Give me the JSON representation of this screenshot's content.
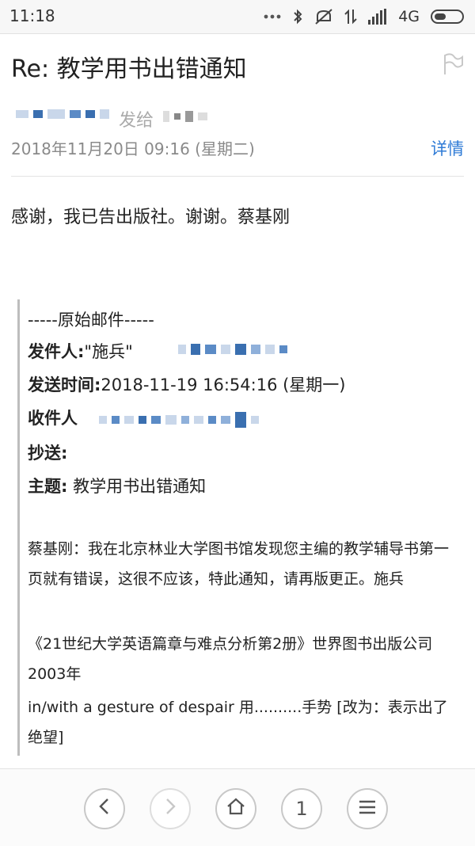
{
  "status": {
    "time": "11:18",
    "network": "4G"
  },
  "email": {
    "subject": "Re: 教学用书出错通知",
    "send_to_label": "发给",
    "date": "2018年11月20日 09:16 (星期二)",
    "details_label": "详情",
    "body": "感谢，我已告出版社。谢谢。蔡基刚",
    "quote": {
      "header": "-----原始邮件-----",
      "from_label": "发件人:",
      "from_value": "\"施兵\"",
      "sent_label": "发送时间:",
      "sent_value": "2018-11-19 16:54:16 (星期一)",
      "to_label": "收件人",
      "cc_label": "抄送:",
      "subject_label": "主题:",
      "subject_value": "教学用书出错通知",
      "para1": "蔡基刚：我在北京林业大学图书馆发现您主编的教学辅导书第一页就有错误，这很不应该，特此通知，请再版更正。施兵",
      "para2": "《21世纪大学英语篇章与难点分析第2册》世界图书出版公司2003年",
      "para3": "in/with a gesture of despair 用..........手势 [改为：表示出了绝望]"
    }
  },
  "nav": {
    "page_number": "1"
  },
  "icons": {
    "status_right": [
      "more-dots-icon",
      "bluetooth-icon",
      "mute-icon",
      "data-arrows-icon",
      "signal-icon",
      "battery-icon"
    ],
    "flag": "flag-icon",
    "nav": [
      "back-icon",
      "forward-icon",
      "home-icon",
      "menu-icon"
    ]
  },
  "colors": {
    "link": "#2f7bd6",
    "blur": "#3a6fb0",
    "blur_light": "#c9d7ea"
  }
}
